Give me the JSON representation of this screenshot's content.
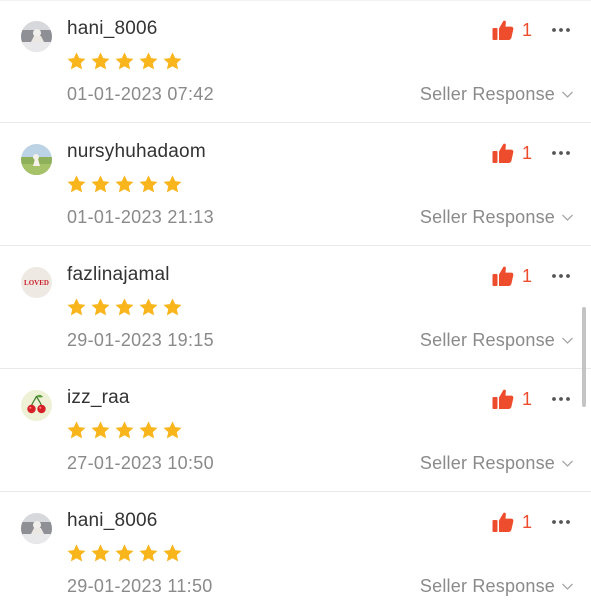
{
  "colors": {
    "star": "#f8b51c",
    "like": "#ee4d2d",
    "username": "#333333",
    "muted": "#8a8a8a",
    "divider": "#e9e9e9"
  },
  "icons": {
    "like": "thumbs-up-icon",
    "more": "more-dots-icon",
    "expand": "chevron-down-icon",
    "star": "star-icon"
  },
  "reviews": [
    {
      "username": "hani_8006",
      "rating": 5,
      "date": "01-01-2023 07:42",
      "likes": "1",
      "seller_response_label": "Seller Response",
      "avatar": "photo-avatar"
    },
    {
      "username": "nursyhuhadaom",
      "rating": 5,
      "date": "01-01-2023 21:13",
      "likes": "1",
      "seller_response_label": "Seller Response",
      "avatar": "landscape-avatar"
    },
    {
      "username": "fazlinajamal",
      "rating": 5,
      "date": "29-01-2023 19:15",
      "likes": "1",
      "seller_response_label": "Seller Response",
      "avatar": "loved-avatar",
      "avatar_text": "LOVED"
    },
    {
      "username": "izz_raa",
      "rating": 5,
      "date": "27-01-2023 10:50",
      "likes": "1",
      "seller_response_label": "Seller Response",
      "avatar": "cherry-avatar"
    },
    {
      "username": "hani_8006",
      "rating": 5,
      "date": "29-01-2023 11:50",
      "likes": "1",
      "seller_response_label": "Seller Response",
      "avatar": "photo-avatar"
    }
  ]
}
